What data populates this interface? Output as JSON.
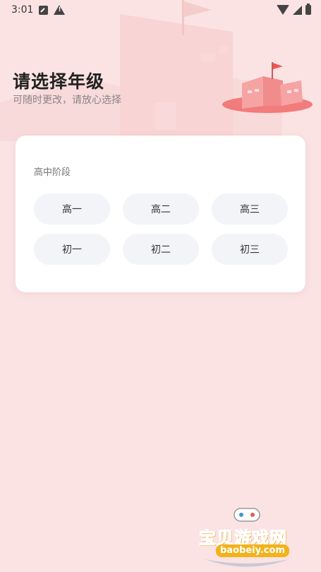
{
  "status_bar": {
    "time": "3:01"
  },
  "header": {
    "title": "请选择年级",
    "subtitle": "可随时更改，请放心选择"
  },
  "card": {
    "section_label": "高中阶段",
    "grades": [
      {
        "label": "高一"
      },
      {
        "label": "高二"
      },
      {
        "label": "高三"
      },
      {
        "label": "初一"
      },
      {
        "label": "初二"
      },
      {
        "label": "初三"
      }
    ]
  },
  "watermark": {
    "title": "宝贝游戏网",
    "url": "baobeiy.com"
  },
  "colors": {
    "background": "#fbe3e3",
    "castle": "#f27b7b",
    "button_bg": "#f3f4f7",
    "watermark": "#f2b21b"
  }
}
